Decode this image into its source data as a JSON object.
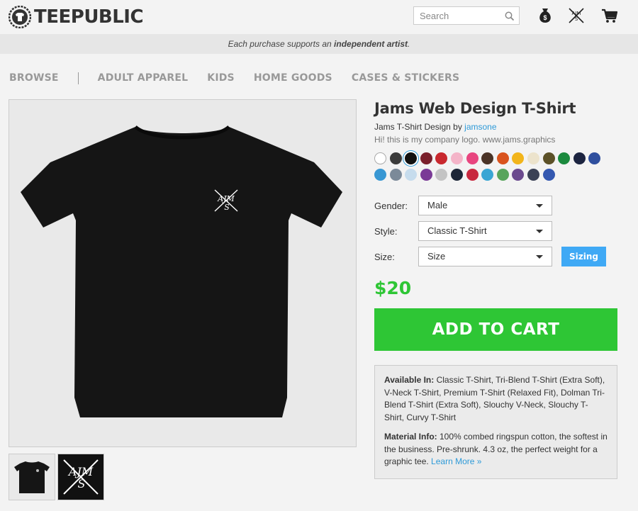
{
  "header": {
    "logo_text": "TEEPUBLIC",
    "search_placeholder": "Search"
  },
  "tagline": {
    "prefix": "Each purchase supports an ",
    "emphasis": "independent artist",
    "suffix": "."
  },
  "nav": {
    "items": [
      "BROWSE",
      "ADULT APPAREL",
      "KIDS",
      "HOME GOODS",
      "CASES & STICKERS"
    ]
  },
  "product": {
    "title": "Jams Web Design T-Shirt",
    "subtitle_prefix": "Jams T-Shirt Design by ",
    "artist": "jamsone",
    "description": "Hi! this is my company logo. www.jams.graphics",
    "logo_letters": "AJMS",
    "swatch_colors": [
      "#ffffff",
      "#3b3b3b",
      "#111111",
      "#7a1f2b",
      "#c8282e",
      "#f4b4c8",
      "#e8457f",
      "#4a3326",
      "#d9531e",
      "#f2b51b",
      "#ece3cc",
      "#5c5128",
      "#1b8a3e",
      "#1c2440",
      "#2f4f9e",
      "#3897d3",
      "#7b8a99",
      "#c6dced",
      "#7a3a96",
      "#c4c4c4",
      "#1d2638",
      "#c8283f",
      "#3aa6d4",
      "#58a55c",
      "#6b4a8e",
      "#3b4155",
      "#3458b0"
    ],
    "selected_swatch": 2,
    "gender_label": "Gender:",
    "gender_value": "Male",
    "style_label": "Style:",
    "style_value": "Classic T-Shirt",
    "size_label": "Size:",
    "size_value": "Size",
    "sizing_label": "Sizing",
    "price": "$20",
    "cart_label": "ADD TO CART",
    "available_label": "Available In:",
    "available_text": " Classic T-Shirt, Tri-Blend T-Shirt (Extra Soft), V-Neck T-Shirt, Premium T-Shirt (Relaxed Fit), Dolman Tri-Blend T-Shirt (Extra Soft), Slouchy V-Neck, Slouchy T-Shirt, Curvy T-Shirt",
    "material_label": "Material Info:",
    "material_text": " 100% combed ringspun cotton, the softest in the business. Pre-shrunk. 4.3 oz, the perfect weight for a graphic tee. ",
    "learn_more": "Learn More »"
  }
}
